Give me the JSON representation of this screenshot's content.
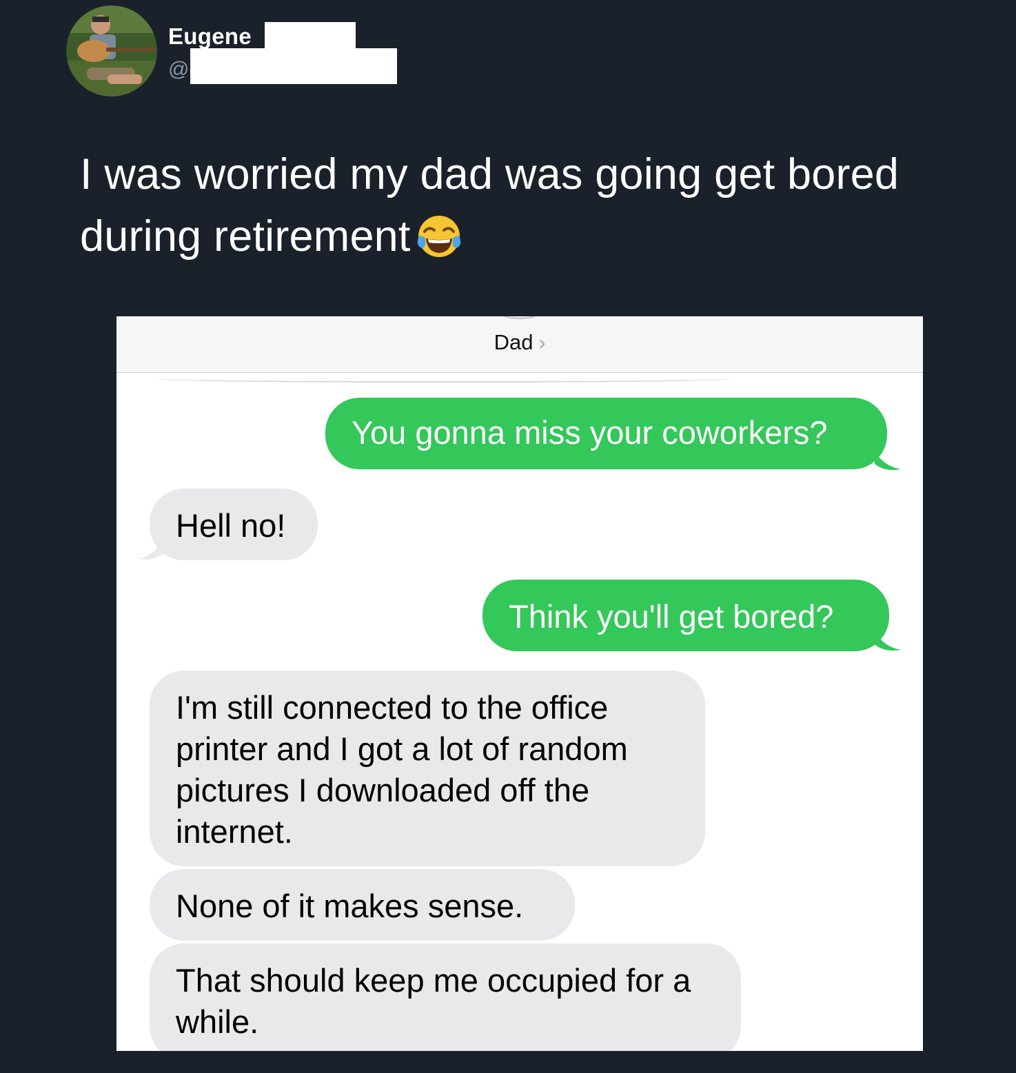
{
  "tweet": {
    "display_name": "Eugene",
    "handle_prefix": "@",
    "text": "I was worried my dad was going get bored during retirement",
    "emoji": "face-with-tears-of-joy"
  },
  "conversation": {
    "contact_name": "Dad",
    "messages": [
      {
        "direction": "outgoing",
        "text": "You gonna miss your coworkers?"
      },
      {
        "direction": "incoming",
        "text": "Hell no!"
      },
      {
        "direction": "outgoing",
        "text": "Think you'll get bored?"
      },
      {
        "direction": "incoming",
        "text": "I'm still connected to the office printer and I got a lot of random pictures I downloaded off the internet."
      },
      {
        "direction": "incoming",
        "text": "None of it makes sense."
      },
      {
        "direction": "incoming",
        "text": "That should keep me occupied for a while."
      }
    ]
  },
  "colors": {
    "background": "#1b212b",
    "outgoing_bubble": "#34c759",
    "incoming_bubble": "#e9e9eb"
  }
}
